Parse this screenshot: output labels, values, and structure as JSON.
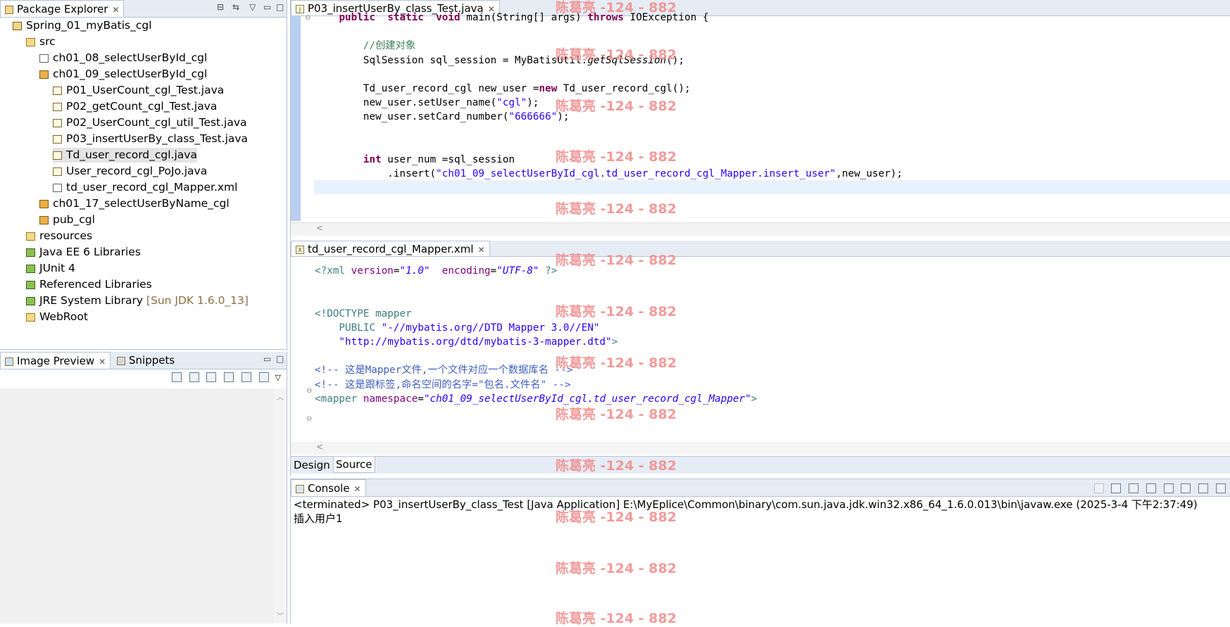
{
  "package_explorer": {
    "tab_label": "Package Explorer",
    "tree": [
      {
        "label": "Spring_01_myBatis_cgl",
        "icon": "project-icon",
        "indent": 0
      },
      {
        "label": "src",
        "icon": "source-folder-icon",
        "indent": 1
      },
      {
        "label": "ch01_08_selectUserById_cgl",
        "icon": "empty-package-icon",
        "indent": 2
      },
      {
        "label": "ch01_09_selectUserById_cgl",
        "icon": "package-icon",
        "indent": 2
      },
      {
        "label": "P01_UserCount_cgl_Test.java",
        "icon": "java-file-icon",
        "indent": 3
      },
      {
        "label": "P02_getCount_cgl_Test.java",
        "icon": "java-file-icon",
        "indent": 3
      },
      {
        "label": "P02_UserCount_cgl_util_Test.java",
        "icon": "java-file-icon",
        "indent": 3
      },
      {
        "label": "P03_insertUserBy_class_Test.java",
        "icon": "java-file-icon",
        "indent": 3
      },
      {
        "label": "Td_user_record_cgl.java",
        "icon": "java-file-icon",
        "indent": 3,
        "selected": true
      },
      {
        "label": "User_record_cgl_PoJo.java",
        "icon": "java-file-icon",
        "indent": 3
      },
      {
        "label": "td_user_record_cgl_Mapper.xml",
        "icon": "xml-file-icon",
        "indent": 3
      },
      {
        "label": "ch01_17_selectUserByName_cgl",
        "icon": "package-icon",
        "indent": 2
      },
      {
        "label": "pub_cgl",
        "icon": "package-icon",
        "indent": 2
      },
      {
        "label": "resources",
        "icon": "source-folder-icon",
        "indent": 1
      },
      {
        "label": "Java EE 6 Libraries",
        "icon": "library-icon",
        "indent": 1
      },
      {
        "label": "JUnit 4",
        "icon": "library-icon",
        "indent": 1
      },
      {
        "label": "Referenced Libraries",
        "icon": "library-icon",
        "indent": 1
      },
      {
        "label": "JRE System Library",
        "suffix": "[Sun JDK 1.6.0_13]",
        "icon": "library-icon",
        "indent": 1
      },
      {
        "label": "WebRoot",
        "icon": "folder-icon",
        "indent": 1
      }
    ]
  },
  "preview": {
    "tab_image_preview": "Image Preview",
    "tab_snippets": "Snippets"
  },
  "java_editor": {
    "tab_label": "P03_insertUserBy_class_Test.java",
    "lines": [
      {
        "indent": "    ",
        "parts": [
          [
            "kw",
            "public"
          ],
          [
            "",
            "  "
          ],
          [
            "kw",
            "static"
          ],
          [
            "",
            "  "
          ],
          [
            "kw",
            "void"
          ],
          [
            "",
            " main(String[] args) "
          ],
          [
            "kw",
            "throws"
          ],
          [
            "",
            " IOException {"
          ]
        ]
      },
      {
        "indent": "",
        "parts": []
      },
      {
        "indent": "        ",
        "parts": [
          [
            "cm",
            "//创建对象"
          ]
        ]
      },
      {
        "indent": "        ",
        "parts": [
          [
            "",
            "SqlSession sql_session = MyBatisUtil."
          ],
          [
            "it",
            "getSqlSession"
          ],
          [
            "",
            "();"
          ]
        ]
      },
      {
        "indent": "",
        "parts": []
      },
      {
        "indent": "        ",
        "parts": [
          [
            "",
            "Td_user_record_cgl new_user ="
          ],
          [
            "kw",
            "new"
          ],
          [
            "",
            " Td_user_record_cgl();"
          ]
        ]
      },
      {
        "indent": "        ",
        "parts": [
          [
            "",
            "new_user.setUser_name("
          ],
          [
            "str",
            "\"cgl\""
          ],
          [
            "",
            ");"
          ]
        ]
      },
      {
        "indent": "        ",
        "parts": [
          [
            "",
            "new_user.setCard_number("
          ],
          [
            "str",
            "\"666666\""
          ],
          [
            "",
            ");"
          ]
        ]
      },
      {
        "indent": "",
        "parts": []
      },
      {
        "indent": "",
        "parts": []
      },
      {
        "indent": "        ",
        "parts": [
          [
            "kw",
            "int"
          ],
          [
            "",
            " user_num =sql_session"
          ]
        ]
      },
      {
        "indent": "            ",
        "parts": [
          [
            "",
            ".insert("
          ],
          [
            "str",
            "\"ch01_09_selectUserById_cgl.td_user_record_cgl_Mapper.insert_user\""
          ],
          [
            "",
            ",new_user);"
          ]
        ]
      }
    ]
  },
  "xml_editor": {
    "tab_label": "td_user_record_cgl_Mapper.xml",
    "lines": [
      {
        "parts": [
          [
            "tag",
            "<?xml "
          ],
          [
            "attr",
            "version"
          ],
          [
            "",
            "="
          ],
          [
            "aval",
            "\"1.0\""
          ],
          [
            "",
            "  "
          ],
          [
            "attr",
            "encoding"
          ],
          [
            "",
            "="
          ],
          [
            "aval",
            "\"UTF-8\""
          ],
          [
            "tag",
            " ?>"
          ]
        ]
      },
      {
        "parts": []
      },
      {
        "parts": []
      },
      {
        "parts": [
          [
            "tag",
            "<!DOCTYPE mapper"
          ]
        ]
      },
      {
        "parts": [
          [
            "tag",
            "    PUBLIC "
          ],
          [
            "str",
            "\"-//mybatis.org//DTD Mapper 3.0//EN\""
          ]
        ]
      },
      {
        "parts": [
          [
            "str",
            "    \"http://mybatis.org/dtd/mybatis-3-mapper.dtd\""
          ],
          [
            "tag",
            ">"
          ]
        ]
      },
      {
        "parts": []
      },
      {
        "parts": [
          [
            "xcm",
            "<!-- 这是Mapper文件,一个文件对应一个数据库名 -->"
          ]
        ]
      },
      {
        "parts": [
          [
            "xcm",
            "<!-- 这是跟标签,命名空间的名字=\"包名.文件名\" -->"
          ]
        ]
      },
      {
        "parts": [
          [
            "tag",
            "<mapper "
          ],
          [
            "attr",
            "namespace"
          ],
          [
            "",
            "="
          ],
          [
            "aval",
            "\"ch01_09_selectUserById_cgl.td_user_record_cgl_Mapper\""
          ],
          [
            "tag",
            ">"
          ]
        ]
      }
    ],
    "bottom_tab_design": "Design",
    "bottom_tab_source": "Source"
  },
  "console": {
    "tab_label": "Console",
    "status_line": "<terminated> P03_insertUserBy_class_Test [Java Application] E:\\MyEplice\\Common\\binary\\com.sun.java.jdk.win32.x86_64_1.6.0.013\\bin\\javaw.exe (2025-3-4 下午2:37:49)",
    "output": "插入用户1"
  },
  "watermark": "陈葛亮 -124 - 882"
}
